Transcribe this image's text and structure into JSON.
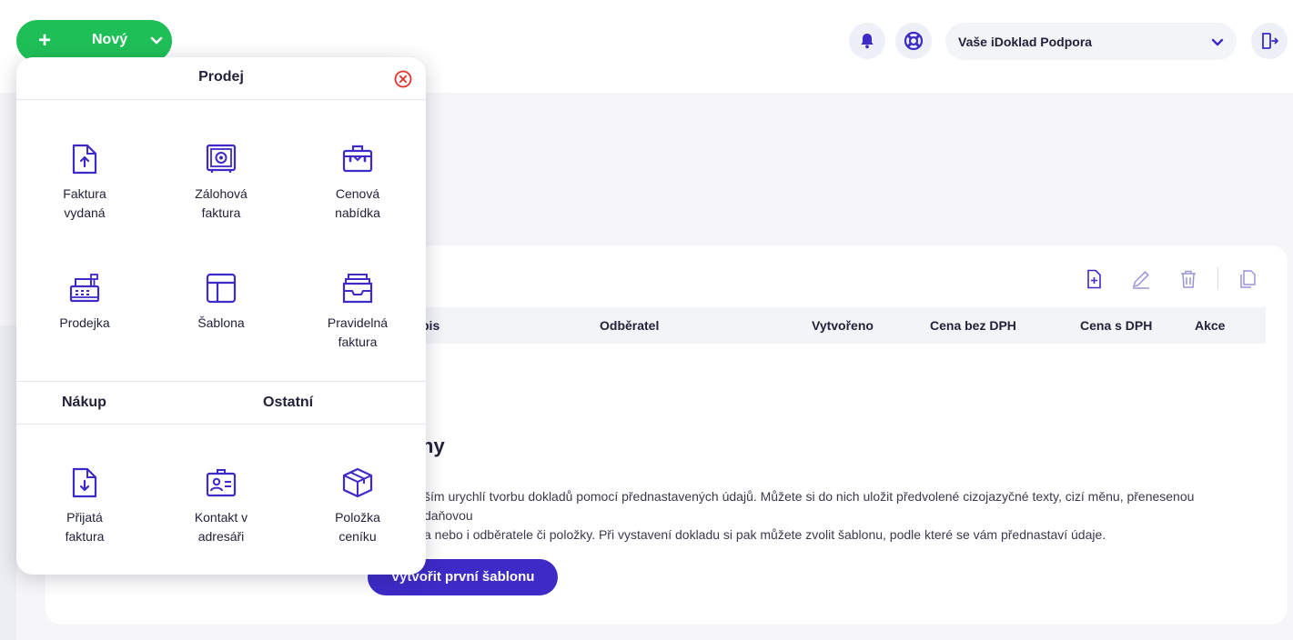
{
  "topbar": {
    "new_button": {
      "label": "Nový"
    },
    "account": {
      "name": "Vaše iDoklad Podpora"
    }
  },
  "toolbar": {
    "icons": [
      "new-document-icon",
      "edit-icon",
      "delete-icon",
      "copy-icon"
    ]
  },
  "table": {
    "columns": [
      "pis",
      "Odběratel",
      "Vytvořeno",
      "Cena bez DPH",
      "Cena s DPH",
      "Akce"
    ]
  },
  "empty_state": {
    "title": "ny",
    "text_line1": "ším urychlí tvorbu dokladů pomocí přednastavených údajů. Můžete si do nich uložit předvolené cizojazyčné texty, cizí měnu, přenesenou daňovou",
    "text_line2": "a nebo i odběratele či položky. Při vystavení dokladu si pak můžete zvolit šablonu, podle které se vám přednastaví údaje.",
    "button": "Vytvořit první šablonu"
  },
  "panel": {
    "title": "Prodej",
    "sales_items": [
      {
        "line1": "Faktura",
        "line2": "vydaná",
        "icon": "invoice-upload-icon"
      },
      {
        "line1": "Zálohová",
        "line2": "faktura",
        "icon": "safe-icon"
      },
      {
        "line1": "Cenová",
        "line2": "nabídka",
        "icon": "briefcase-icon"
      },
      {
        "line1": "Prodejka",
        "line2": "",
        "icon": "cash-register-icon"
      },
      {
        "line1": "Šablona",
        "line2": "",
        "icon": "template-icon"
      },
      {
        "line1": "Pravidelná",
        "line2": "faktura",
        "icon": "inbox-stack-icon"
      }
    ],
    "tabs": {
      "purchase": "Nákup",
      "other": "Ostatní"
    },
    "other_items": [
      {
        "line1": "Přijatá",
        "line2": "faktura",
        "icon": "invoice-download-icon"
      },
      {
        "line1": "Kontakt v",
        "line2": "adresáři",
        "icon": "contact-card-icon"
      },
      {
        "line1": "Položka",
        "line2": "ceníku",
        "icon": "box-icon"
      }
    ]
  },
  "colors": {
    "primary": "#3d2ac7",
    "green": "#1fbf57",
    "close": "#e0322b"
  }
}
